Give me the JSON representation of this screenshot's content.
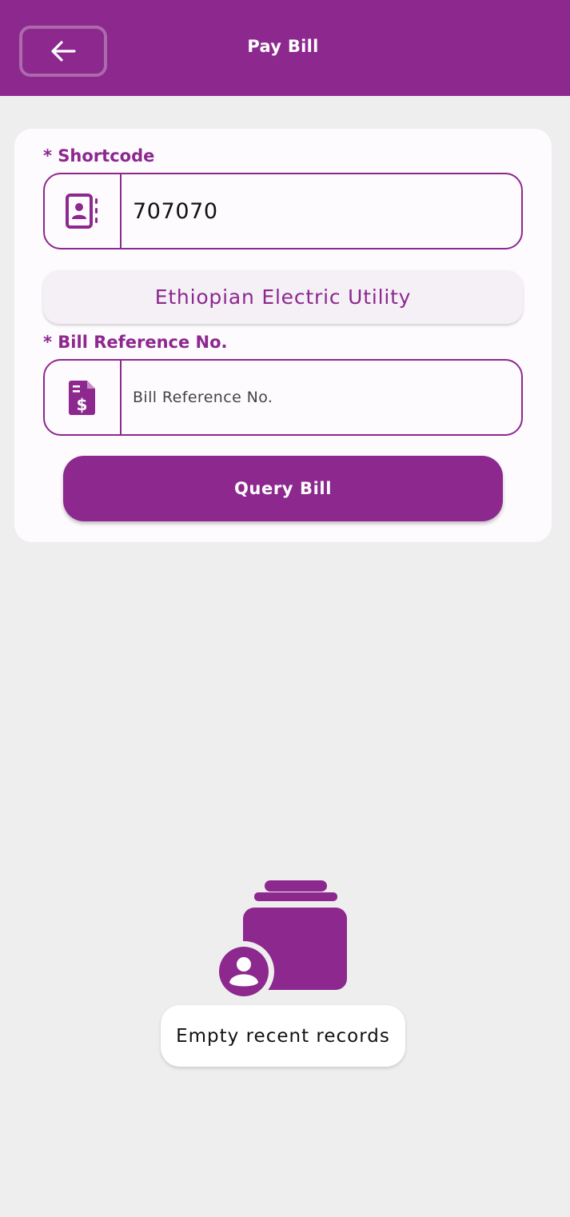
{
  "header": {
    "title": "Pay Bill",
    "back_icon": "arrow-left-icon"
  },
  "form": {
    "shortcode": {
      "label": "* Shortcode",
      "value": "707070",
      "icon": "contact-card-icon"
    },
    "biller_name": "Ethiopian Electric Utility",
    "bill_reference": {
      "label": "* Bill Reference No.",
      "placeholder": "Bill Reference No.",
      "value": "",
      "icon": "bill-dollar-icon"
    },
    "query_button": "Query Bill"
  },
  "empty_state": {
    "message": "Empty recent records",
    "icon": "empty-records-icon"
  },
  "colors": {
    "brand": "#8c288e",
    "background": "#eeeeee",
    "card": "#fefbfe"
  }
}
